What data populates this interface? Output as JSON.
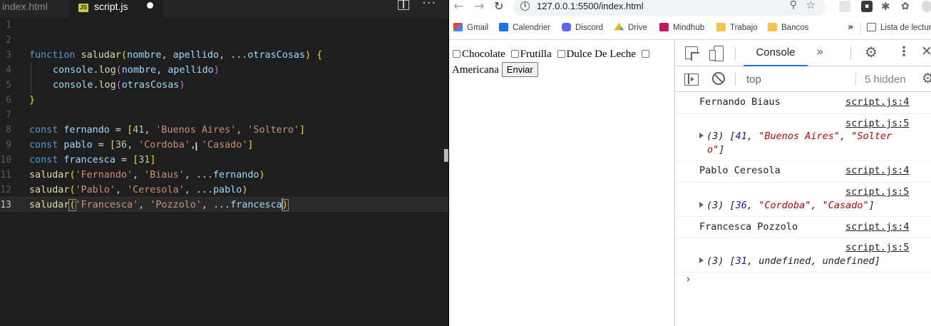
{
  "editor": {
    "tabs": [
      {
        "label": "index.html"
      },
      {
        "label": "script.js",
        "badge": "JS"
      }
    ],
    "actions": {
      "more": "···"
    },
    "line_numbers": [
      "1",
      "2",
      "3",
      "4",
      "5",
      "6",
      "7",
      "8",
      "9",
      "10",
      "11",
      "12",
      "13"
    ],
    "code": {
      "l3": {
        "kw": "function",
        "fn": "saludar",
        "p1": "nombre",
        "p2": "apellido",
        "spread": "...",
        "p3": "otrasCosas"
      },
      "l4": {
        "obj": "console",
        "method": "log",
        "a1": "nombre",
        "a2": "apellido"
      },
      "l5": {
        "obj": "console",
        "method": "log",
        "a1": "otrasCosas"
      },
      "l8": {
        "kw": "const",
        "name": "fernando",
        "n": "41",
        "s1": "'Buenos Aires'",
        "s2": "'Soltero'"
      },
      "l9": {
        "kw": "const",
        "name": "pablo",
        "n": "36",
        "s1": "'Cordoba'",
        "s2": "'Casado'"
      },
      "l10": {
        "kw": "const",
        "name": "francesca",
        "n": "31"
      },
      "l11": {
        "fn": "saludar",
        "s1": "'Fernando'",
        "s2": "'Biaus'",
        "spread": "...",
        "arg": "fernando"
      },
      "l12": {
        "fn": "saludar",
        "s1": "'Pablo'",
        "s2": "'Ceresola'",
        "spread": "...",
        "arg": "pablo"
      },
      "l13": {
        "fn": "saludar",
        "s1": "'Francesca'",
        "s2": "'Pozzolo'",
        "spread": "...",
        "arg": "francesca"
      }
    }
  },
  "browser": {
    "url": "127.0.0.1:5500/index.html",
    "bookmarks": [
      {
        "label": "Gmail"
      },
      {
        "label": "Calendrier"
      },
      {
        "label": "Discord"
      },
      {
        "label": "Drive"
      },
      {
        "label": "Mindhub"
      },
      {
        "label": "Trabajo"
      },
      {
        "label": "Bancos"
      },
      {
        "label": "Lista de lectura"
      }
    ],
    "bookmarks_more": "»",
    "page": {
      "flavors": [
        "Chocolate",
        "Frutilla",
        "Dulce De Leche",
        "Americana"
      ],
      "submit_label": "Enviar"
    }
  },
  "devtools": {
    "active_tab": "Console",
    "more_tabs": "»",
    "context": "top",
    "hidden": "5 hidden",
    "messages": [
      {
        "text": "Fernando Biaus",
        "source": "script.js:4"
      },
      {
        "source": "script.js:5",
        "count": "(3)",
        "num": "41",
        "s1": "\"Buenos Aires\"",
        "s2a": "\"Solter",
        "s2b": "o\""
      },
      {
        "text": "Pablo Ceresola",
        "source": "script.js:4"
      },
      {
        "source": "script.js:5",
        "count": "(3)",
        "num": "36",
        "s1": "\"Cordoba\"",
        "s2": "\"Casado\""
      },
      {
        "text": "Francesca Pozzolo",
        "source": "script.js:4"
      },
      {
        "source": "script.js:5",
        "count": "(3)",
        "num": "31",
        "u1": "undefined",
        "u2": "undefined"
      }
    ],
    "prompt": "›"
  }
}
